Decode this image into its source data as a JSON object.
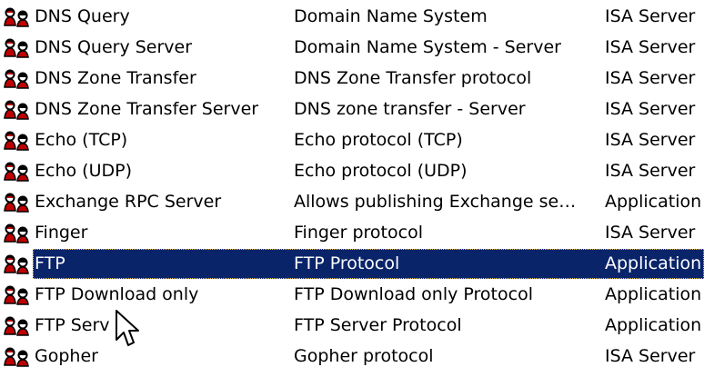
{
  "rows": [
    {
      "name": "DNS Query",
      "description": "Domain Name System",
      "type": "ISA Server",
      "icon": "protocol-users-icon",
      "selected": false
    },
    {
      "name": "DNS Query Server",
      "description": "Domain Name System - Server",
      "type": "ISA Server",
      "icon": "protocol-users-icon",
      "selected": false
    },
    {
      "name": "DNS Zone Transfer",
      "description": "DNS Zone Transfer protocol",
      "type": "ISA Server",
      "icon": "protocol-users-icon",
      "selected": false
    },
    {
      "name": "DNS Zone Transfer Server",
      "description": "DNS zone transfer - Server",
      "type": "ISA Server",
      "icon": "protocol-users-icon",
      "selected": false
    },
    {
      "name": "Echo (TCP)",
      "description": "Echo protocol (TCP)",
      "type": "ISA Server",
      "icon": "protocol-users-icon",
      "selected": false
    },
    {
      "name": "Echo (UDP)",
      "description": "Echo protocol (UDP)",
      "type": "ISA Server",
      "icon": "protocol-users-icon",
      "selected": false
    },
    {
      "name": "Exchange RPC Server",
      "description": "Allows publishing Exchange se…",
      "type": "Application",
      "icon": "protocol-users-icon",
      "selected": false
    },
    {
      "name": "Finger",
      "description": "Finger protocol",
      "type": "ISA Server",
      "icon": "protocol-users-icon",
      "selected": false
    },
    {
      "name": "FTP",
      "description": "FTP Protocol",
      "type": "Application",
      "icon": "protocol-users-icon",
      "selected": true
    },
    {
      "name": "FTP Download only",
      "description": "FTP Download only Protocol",
      "type": "Application",
      "icon": "protocol-users-icon",
      "selected": false
    },
    {
      "name": "FTP Serv",
      "description": "FTP Server Protocol",
      "type": "Application",
      "icon": "protocol-users-icon",
      "selected": false
    },
    {
      "name": "Gopher",
      "description": "Gopher protocol",
      "type": "ISA Server",
      "icon": "protocol-users-icon",
      "selected": false
    }
  ],
  "colors": {
    "selection_background": "#0a246a",
    "selection_text": "#ffffff",
    "text": "#000000",
    "icon_red": "#c00000"
  },
  "cursor": {
    "icon": "mouse-pointer-icon"
  }
}
